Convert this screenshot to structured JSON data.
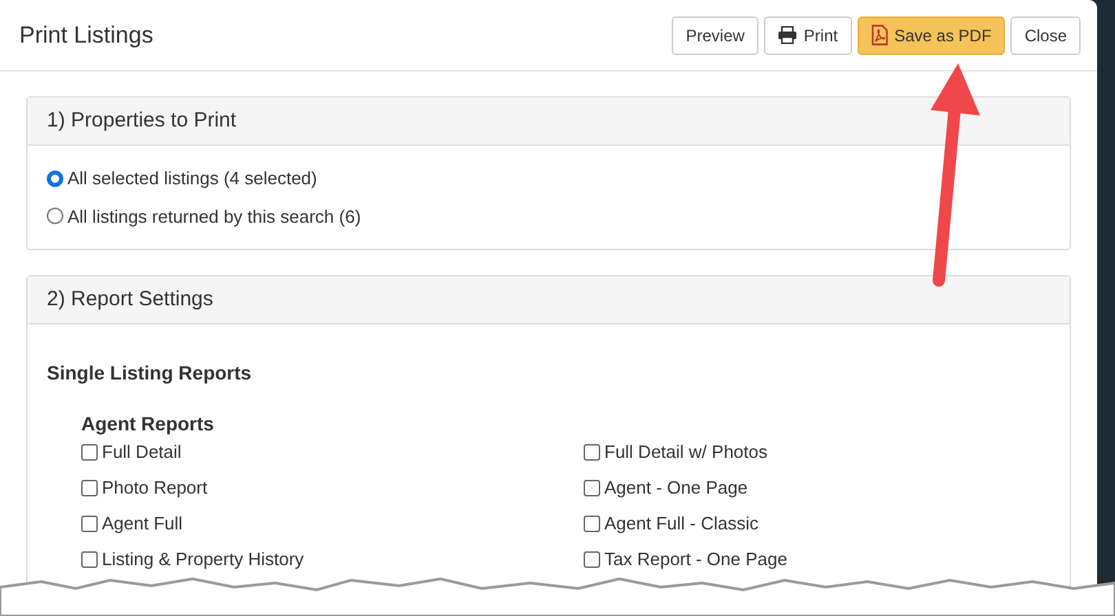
{
  "dialog": {
    "title": "Print Listings",
    "buttons": [
      {
        "label": "Preview",
        "kind": "default"
      },
      {
        "label": "Print",
        "kind": "print"
      },
      {
        "label": "Save as PDF",
        "kind": "pdf"
      },
      {
        "label": "Close",
        "kind": "default"
      }
    ]
  },
  "properties_panel": {
    "title": "1) Properties to Print",
    "options": [
      {
        "label": "All selected listings (4 selected)",
        "selected": true
      },
      {
        "label": "All listings returned by this search (6)",
        "selected": false
      }
    ]
  },
  "report_panel": {
    "title": "2) Report Settings",
    "heading": "Single Listing Reports",
    "group": "Agent Reports",
    "options": [
      {
        "label": "Full Detail",
        "checked": false
      },
      {
        "label": "Full Detail w/ Photos",
        "checked": false
      },
      {
        "label": "Photo Report",
        "checked": false
      },
      {
        "label": "Agent - One Page",
        "checked": false
      },
      {
        "label": "Agent Full",
        "checked": false
      },
      {
        "label": "Agent Full - Classic",
        "checked": false
      },
      {
        "label": "Listing & Property History",
        "checked": false
      },
      {
        "label": "Tax Report - One Page",
        "checked": false
      }
    ]
  }
}
